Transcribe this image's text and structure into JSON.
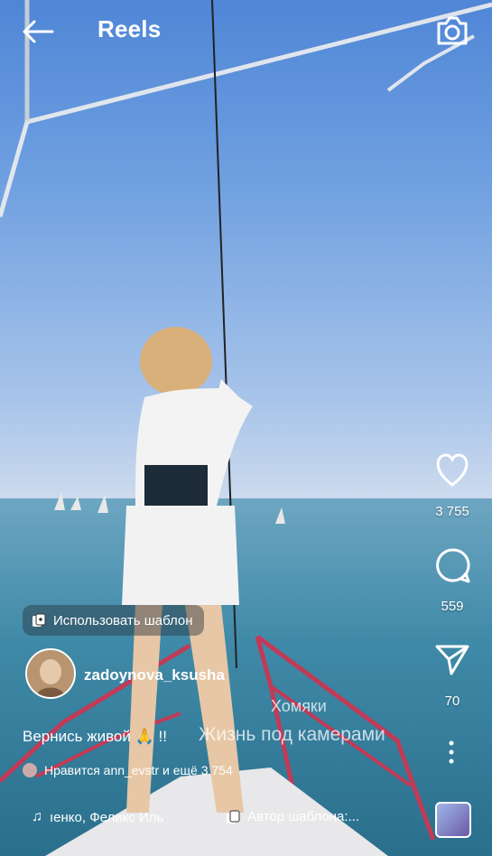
{
  "header": {
    "title": "Reels",
    "back_icon": "arrow-left-icon",
    "camera_icon": "camera-icon"
  },
  "actions": {
    "likes": "3 755",
    "comments": "559",
    "shares": "70"
  },
  "template_button": {
    "label": "Использовать шаблон"
  },
  "post": {
    "username": "zadoynova_ksusha",
    "caption": "Вернись живой 🙏 !!",
    "liked_by": "Нравится ann_evstr и ещё 3 754"
  },
  "music": {
    "title": "Хомяки",
    "subtitle": "Жизнь под камерами",
    "audio_label": "ıенко, Феликс Иль",
    "template_author": "Автор шаблона:..."
  },
  "colors": {
    "text": "#ffffff",
    "pill_bg": "rgba(40,50,60,0.45)"
  }
}
